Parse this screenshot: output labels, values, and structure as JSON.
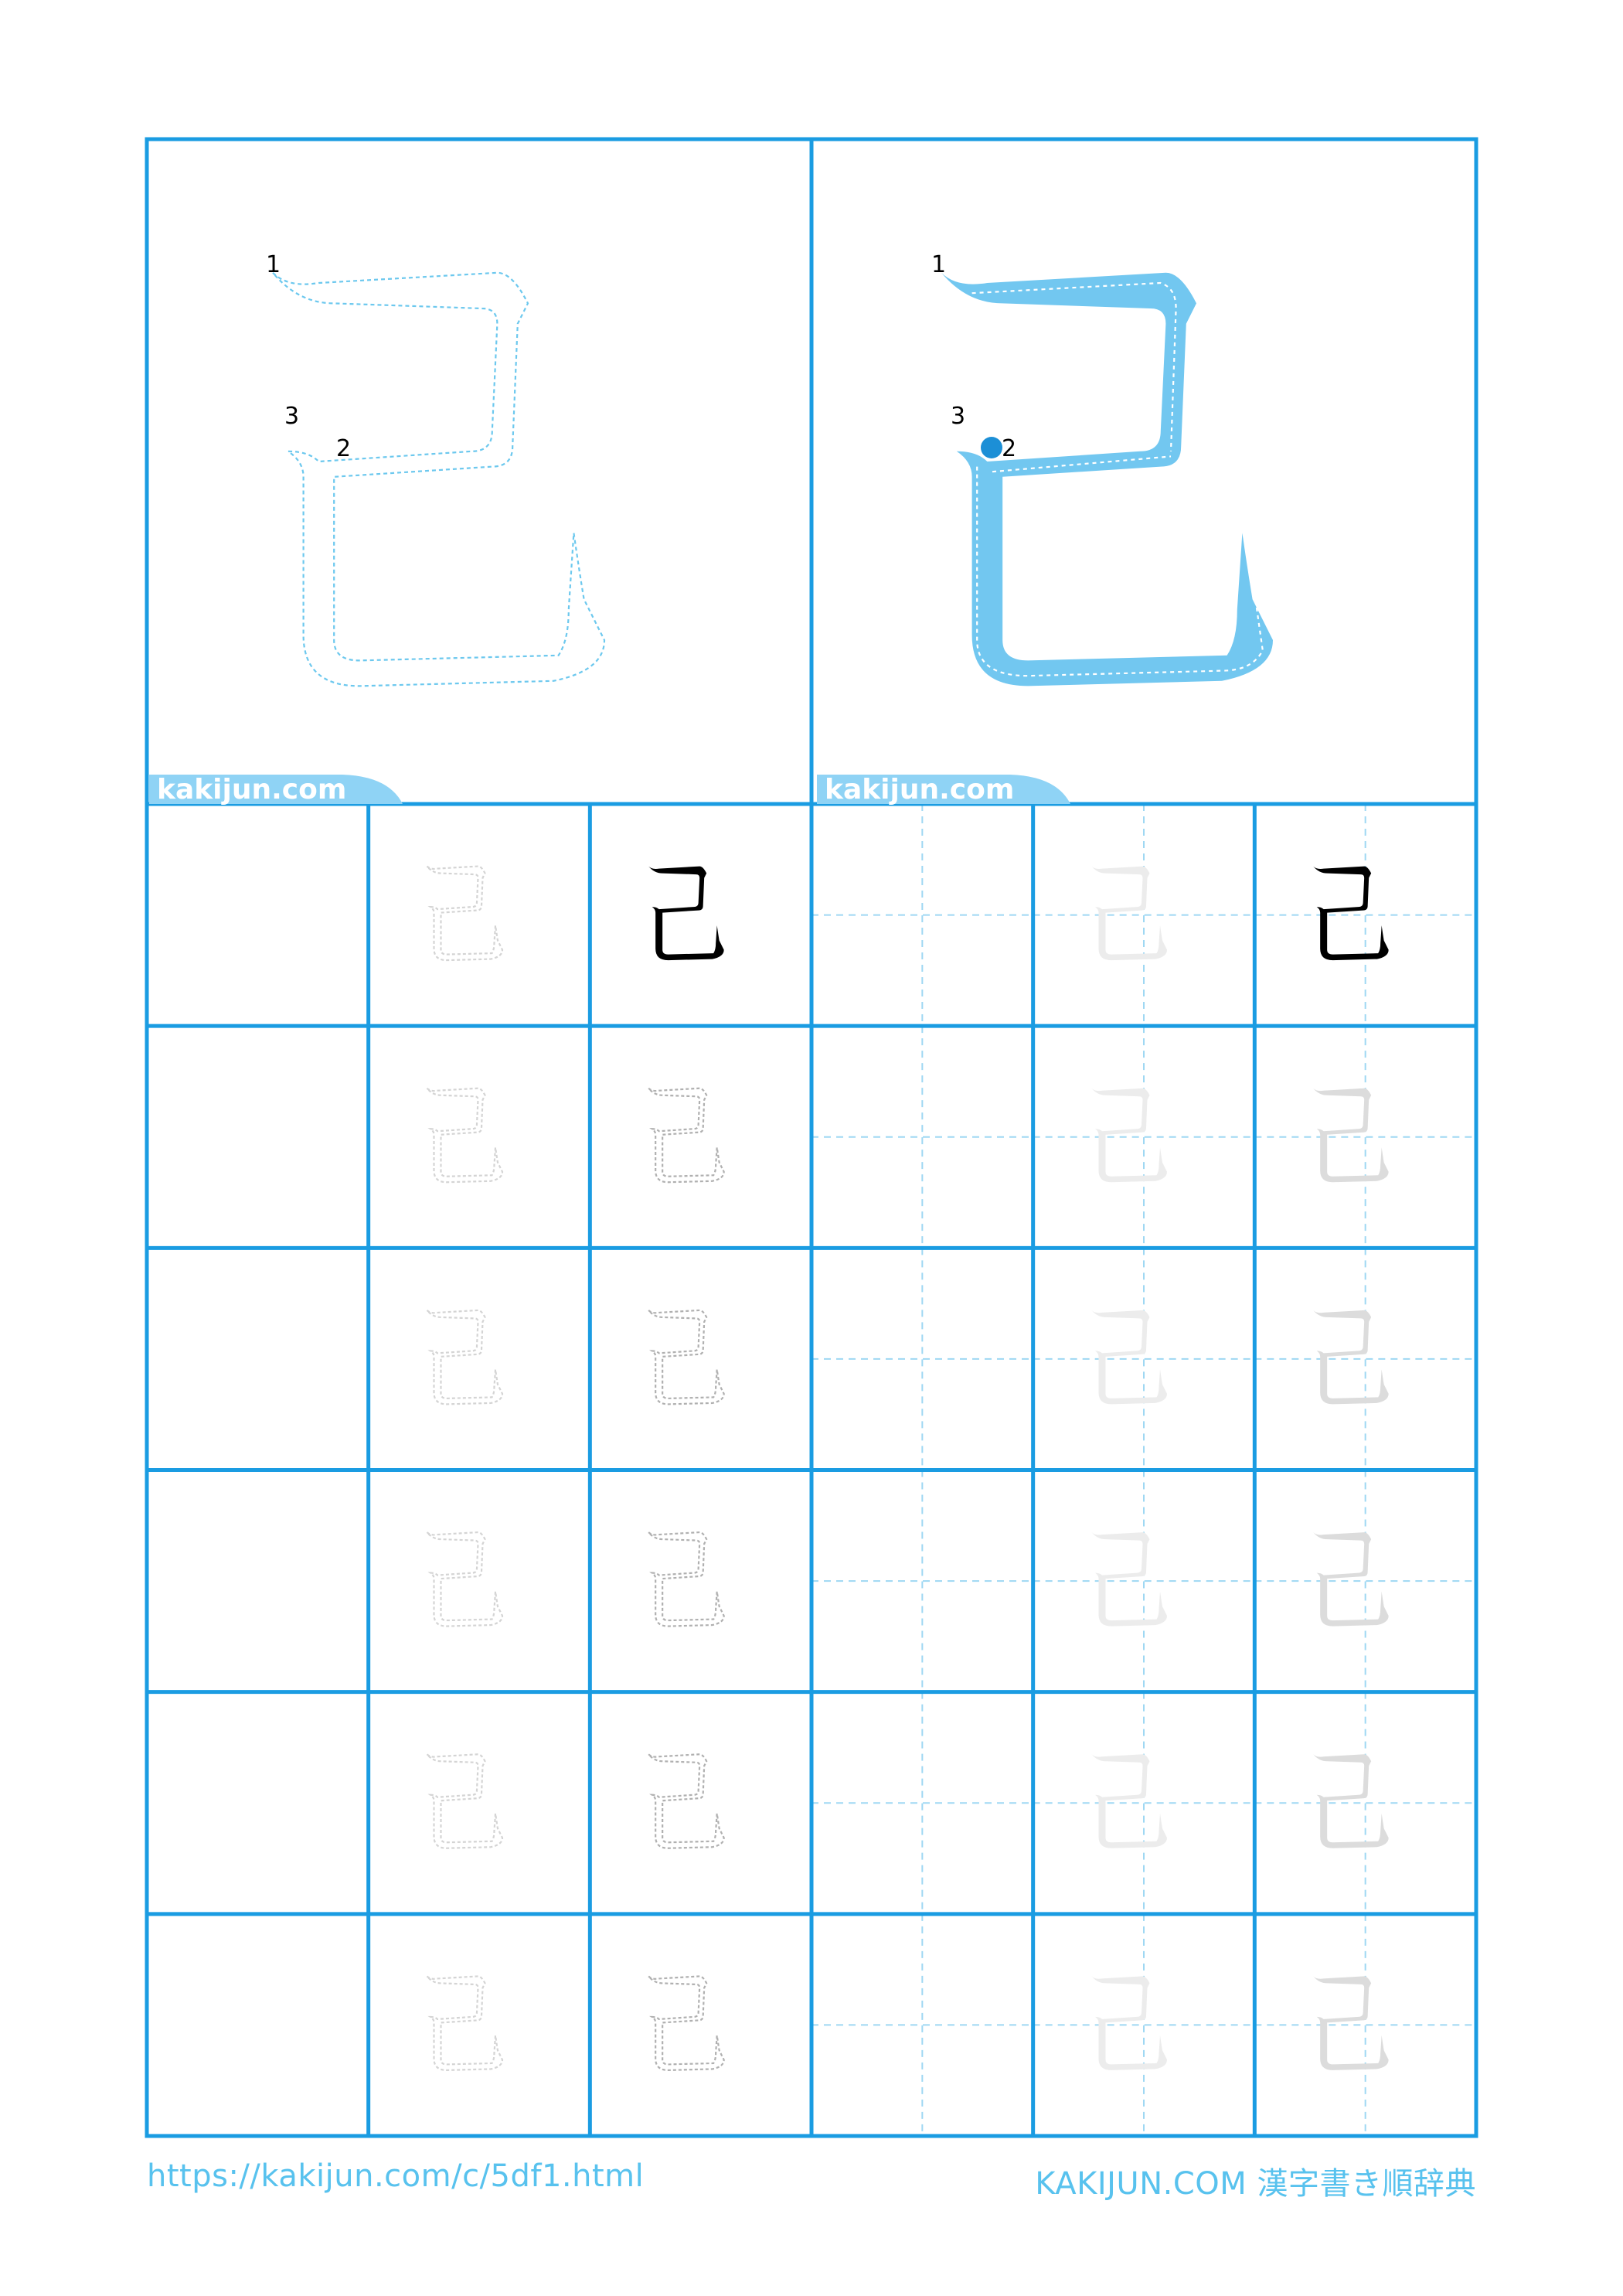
{
  "character": "己",
  "stroke_numbers": [
    "1",
    "2",
    "3"
  ],
  "site_label": "kakijun.com",
  "practice_rows": 6,
  "footer": {
    "url": "https://kakijun.com/c/5df1.html",
    "brand": "KAKIJUN.COM 漢字書き順辞典"
  },
  "colors": {
    "grid_line": "#1a9ce2",
    "guide_line": "#9fd8f3",
    "stroke_fill": "#72c7f0",
    "trace_outline": "#6cc8ee",
    "model_black": "#000000",
    "accent_text": "#58c2ee"
  }
}
